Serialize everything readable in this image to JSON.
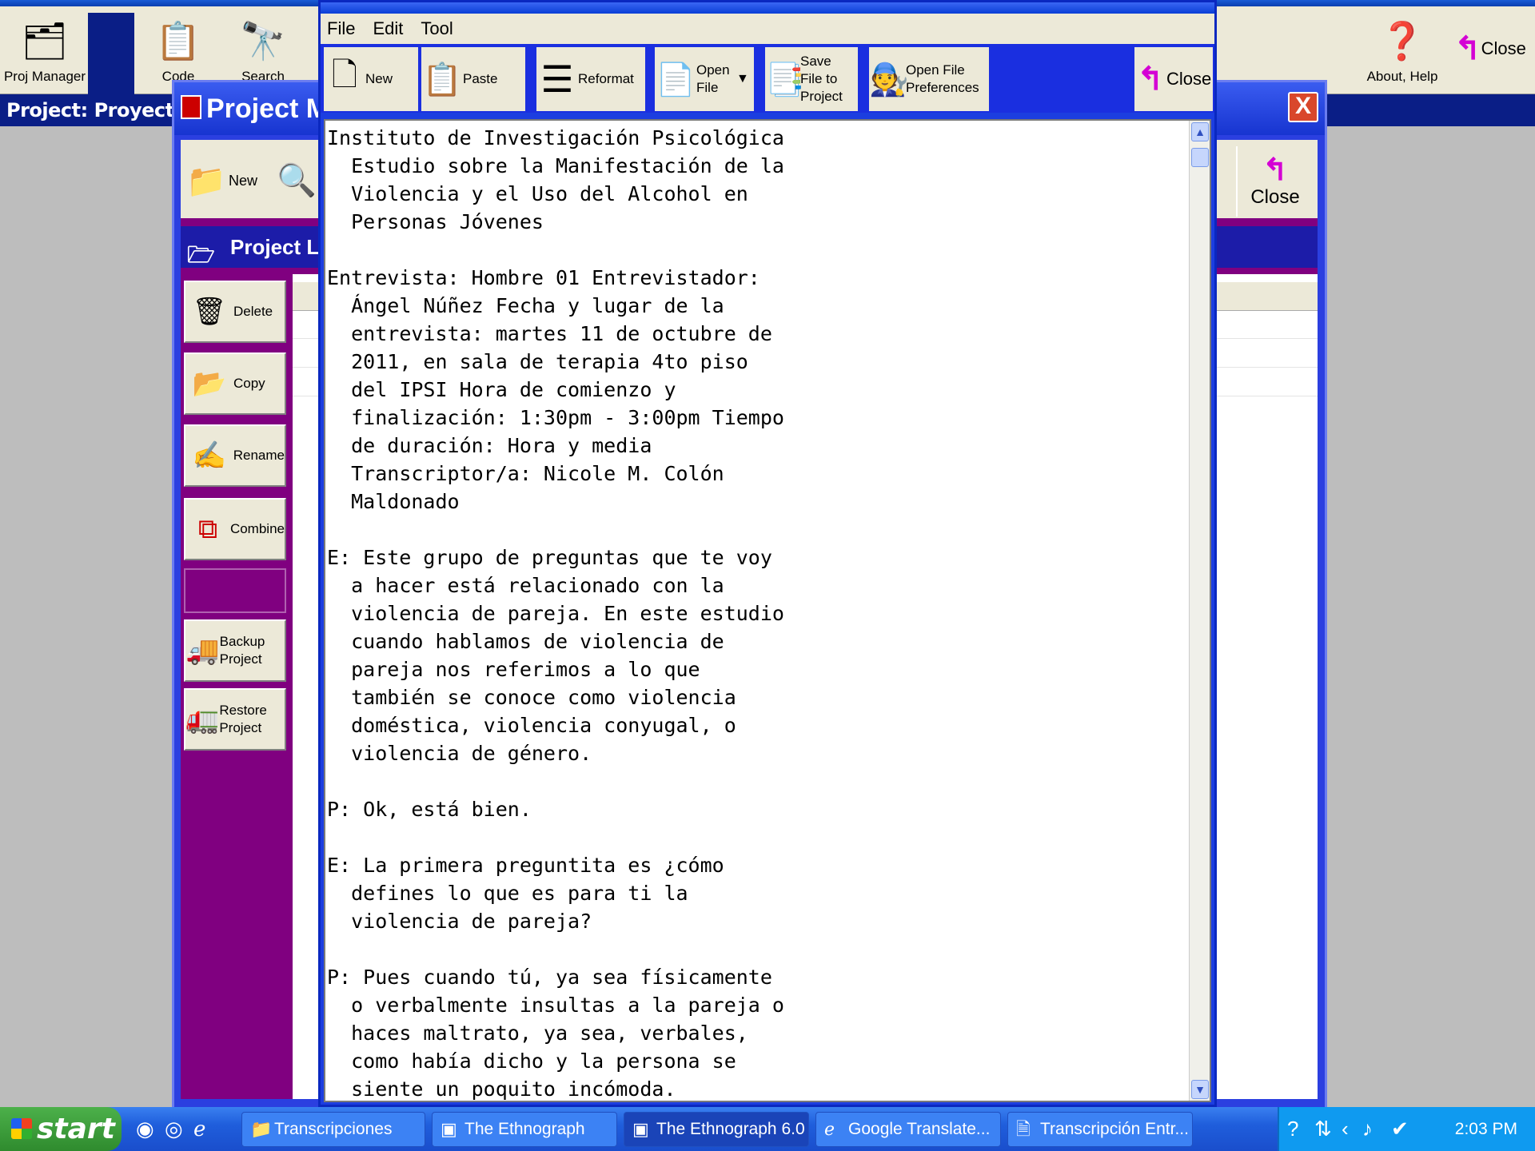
{
  "main_app": {
    "toolbar": {
      "proj_manager": "Proj Manager",
      "code": "Code",
      "search": "Search",
      "about_help": "About, Help",
      "close": "Close"
    },
    "project_label": "Project: Proyecto Vio"
  },
  "project_manager": {
    "title": "Project Ma",
    "close_symbol": "X",
    "toolbar": {
      "new": "New",
      "close": "Close"
    },
    "list_header": "Project Li",
    "sidebar": [
      {
        "label": "Delete",
        "icon": "trash-icon"
      },
      {
        "label": "Copy",
        "icon": "copy-icon"
      },
      {
        "label": "Rename",
        "icon": "rename-icon"
      },
      {
        "label": "Combine",
        "icon": "combine-icon"
      },
      {
        "label": "",
        "icon": ""
      },
      {
        "label": "Backup Project",
        "icon": "backup-icon"
      },
      {
        "label": "Restore Project",
        "icon": "restore-icon"
      }
    ]
  },
  "editor": {
    "menu": [
      "File",
      "Edit",
      "Tool"
    ],
    "toolbar": {
      "new": "New",
      "paste": "Paste",
      "reformat": "Reformat",
      "open_file": "Open File",
      "save_to_project": "Save File to Project",
      "open_prefs": "Open File Preferences",
      "close": "Close"
    },
    "text": "Instituto de Investigación Psicológica\n  Estudio sobre la Manifestación de la\n  Violencia y el Uso del Alcohol en\n  Personas Jóvenes\n\nEntrevista: Hombre 01 Entrevistador:\n  Ángel Núñez Fecha y lugar de la\n  entrevista: martes 11 de octubre de\n  2011, en sala de terapia 4to piso\n  del IPSI Hora de comienzo y\n  finalización: 1:30pm - 3:00pm Tiempo\n  de duración: Hora y media\n  Transcriptor/a: Nicole M. Colón\n  Maldonado\n\nE: Este grupo de preguntas que te voy\n  a hacer está relacionado con la\n  violencia de pareja. En este estudio\n  cuando hablamos de violencia de\n  pareja nos referimos a lo que\n  también se conoce como violencia\n  doméstica, violencia conyugal, o\n  violencia de género.\n\nP: Ok, está bien.\n\nE: La primera preguntita es ¿cómo\n  defines lo que es para ti la\n  violencia de pareja?\n\nP: Pues cuando tú, ya sea físicamente\n  o verbalmente insultas a la pareja o\n  haces maltrato, ya sea, verbales,\n  como había dicho y la persona se\n  siente un poquito incómoda."
  },
  "taskbar": {
    "start": "start",
    "items": [
      {
        "label": "Transcripciones",
        "icon": "folder-icon"
      },
      {
        "label": "The Ethnograph",
        "icon": "app-icon"
      },
      {
        "label": "The Ethnograph 6.0",
        "icon": "app-icon"
      },
      {
        "label": "Google Translate...",
        "icon": "ie-icon"
      },
      {
        "label": "Transcripción Entr...",
        "icon": "doc-icon"
      }
    ],
    "clock": "2:03 PM"
  }
}
